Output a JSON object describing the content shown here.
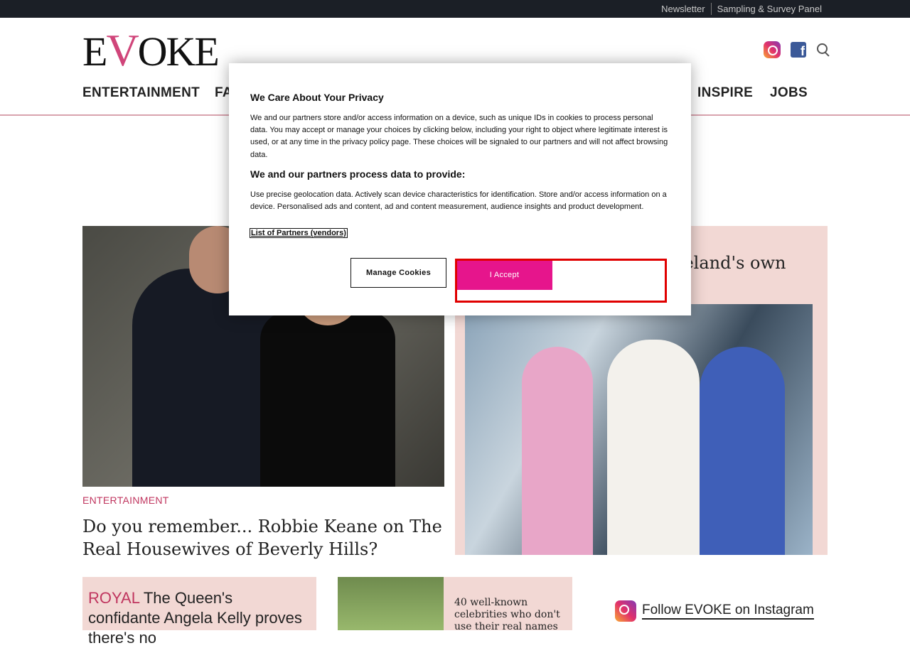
{
  "topbar": {
    "links": [
      "Newsletter",
      "Sampling & Survey Panel"
    ]
  },
  "logo": {
    "text_e": "E",
    "text_v": "V",
    "text_rest": "OKE"
  },
  "social": {
    "icons": [
      "instagram-icon",
      "facebook-icon",
      "search-icon"
    ]
  },
  "nav": {
    "items": [
      "ENTERTAINMENT",
      "FA",
      "INSPIRE",
      "JOBS"
    ]
  },
  "main_article": {
    "category": "ENTERTAINMENT",
    "title": "Do you remember... Robbie Keane on The Real Housewives of Beverly Hills?"
  },
  "right_article": {
    "title_fragment": "reland's own"
  },
  "small_article1": {
    "category": "ROYAL",
    "title": "The Queen's confidante Angela Kelly proves there's no"
  },
  "small_article2": {
    "title": "40 well-known celebrities who don't use their real names"
  },
  "follow": {
    "label": "Follow EVOKE on Instagram"
  },
  "cookie_dialog": {
    "title": "We Care About Your Privacy",
    "body": "We and our partners store and/or access information on a device, such as unique IDs in cookies to process personal data. You may accept or manage your choices by clicking below, including your right to object where legitimate interest is used, or at any time in the privacy policy page. These choices will be signaled to our partners and will not affect browsing data.",
    "subtitle": "We and our partners process data to provide:",
    "body2": "Use precise geolocation data. Actively scan device characteristics for identification. Store and/or access information on a device. Personalised ads and content, ad and content measurement, audience insights and product development.",
    "partners_link": "List of Partners (vendors)",
    "manage_button": "Manage Cookies",
    "accept_button": "I Accept"
  },
  "colors": {
    "accent": "#c0365f",
    "accept": "#e6158c",
    "highlight": "#e00000",
    "topbar": "#1b1f26"
  }
}
